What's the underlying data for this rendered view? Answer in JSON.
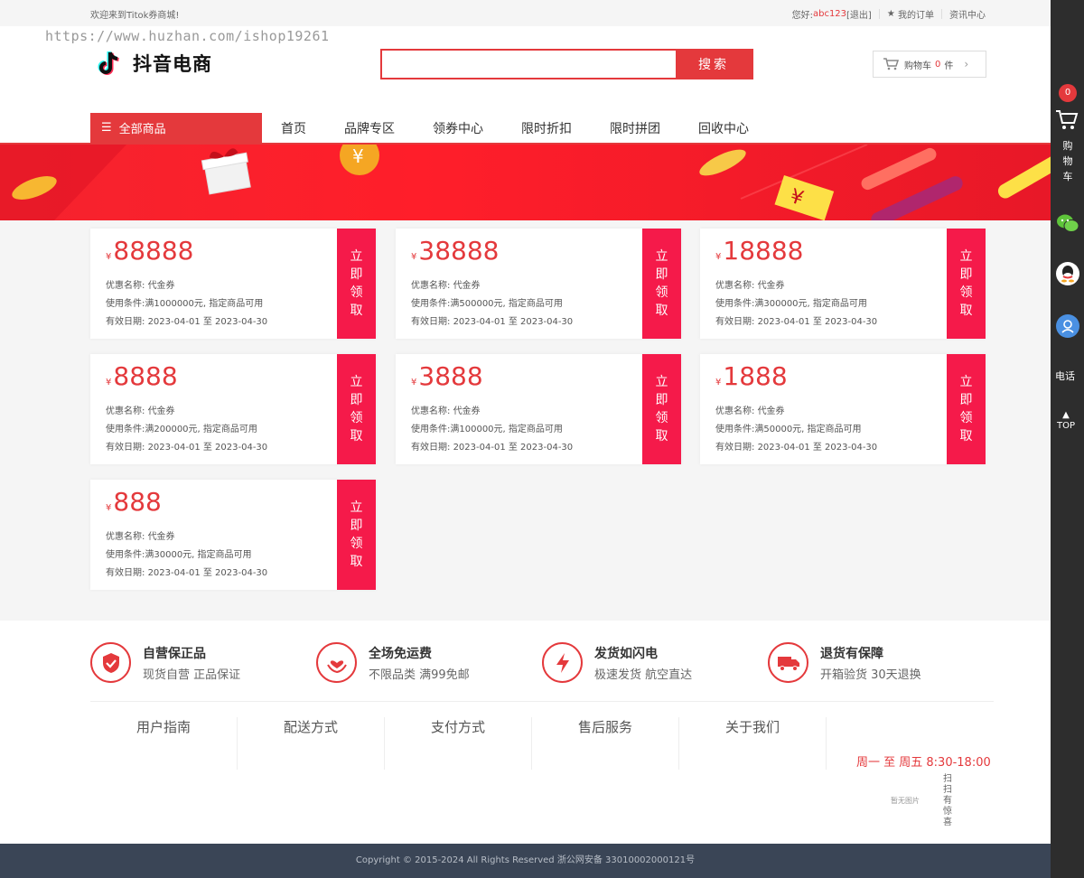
{
  "topbar": {
    "welcome": "欢迎来到Titok券商城!",
    "greeting": "您好:",
    "username": "abc123",
    "logout": "[退出]",
    "orders": "我的订单",
    "news": "资讯中心"
  },
  "header": {
    "watermark": "https://www.huzhan.com/ishop19261",
    "logo_text": "抖音电商",
    "search_placeholder": "",
    "search_button": "搜索",
    "cart_label": "购物车",
    "cart_count": "0",
    "cart_unit": "件"
  },
  "nav": {
    "all_categories": "全部商品",
    "links": [
      "首页",
      "品牌专区",
      "领券中心",
      "限时折扣",
      "限时拼团",
      "回收中心"
    ]
  },
  "coupons": [
    {
      "yen": "¥",
      "amount": "88888",
      "name_label": "优惠名称:",
      "name": "代金券",
      "cond_label": "使用条件:",
      "condition": "满1000000元, 指定商品可用",
      "date_label": "有效日期:",
      "dates": "2023-04-01 至 2023-04-30",
      "grab": [
        "立",
        "即",
        "领",
        "取"
      ]
    },
    {
      "yen": "¥",
      "amount": "38888",
      "name_label": "优惠名称:",
      "name": "代金券",
      "cond_label": "使用条件:",
      "condition": "满500000元, 指定商品可用",
      "date_label": "有效日期:",
      "dates": "2023-04-01 至 2023-04-30",
      "grab": [
        "立",
        "即",
        "领",
        "取"
      ]
    },
    {
      "yen": "¥",
      "amount": "18888",
      "name_label": "优惠名称:",
      "name": "代金券",
      "cond_label": "使用条件:",
      "condition": "满300000元, 指定商品可用",
      "date_label": "有效日期:",
      "dates": "2023-04-01 至 2023-04-30",
      "grab": [
        "立",
        "即",
        "领",
        "取"
      ]
    },
    {
      "yen": "¥",
      "amount": "8888",
      "name_label": "优惠名称:",
      "name": "代金券",
      "cond_label": "使用条件:",
      "condition": "满200000元, 指定商品可用",
      "date_label": "有效日期:",
      "dates": "2023-04-01 至 2023-04-30",
      "grab": [
        "立",
        "即",
        "领",
        "取"
      ]
    },
    {
      "yen": "¥",
      "amount": "3888",
      "name_label": "优惠名称:",
      "name": "代金券",
      "cond_label": "使用条件:",
      "condition": "满100000元, 指定商品可用",
      "date_label": "有效日期:",
      "dates": "2023-04-01 至 2023-04-30",
      "grab": [
        "立",
        "即",
        "领",
        "取"
      ]
    },
    {
      "yen": "¥",
      "amount": "1888",
      "name_label": "优惠名称:",
      "name": "代金券",
      "cond_label": "使用条件:",
      "condition": "满50000元, 指定商品可用",
      "date_label": "有效日期:",
      "dates": "2023-04-01 至 2023-04-30",
      "grab": [
        "立",
        "即",
        "领",
        "取"
      ]
    },
    {
      "yen": "¥",
      "amount": "888",
      "name_label": "优惠名称:",
      "name": "代金券",
      "cond_label": "使用条件:",
      "condition": "满30000元, 指定商品可用",
      "date_label": "有效日期:",
      "dates": "2023-04-01 至 2023-04-30",
      "grab": [
        "立",
        "即",
        "领",
        "取"
      ]
    }
  ],
  "services": [
    {
      "icon": "shield-check-icon",
      "title": "自营保正品",
      "desc": "现货自营 正品保证"
    },
    {
      "icon": "heart-hand-icon",
      "title": "全场免运费",
      "desc": "不限品类 满99免邮"
    },
    {
      "icon": "lightning-icon",
      "title": "发货如闪电",
      "desc": "极速发货 航空直达"
    },
    {
      "icon": "truck-icon",
      "title": "退货有保障",
      "desc": "开箱验货 30天退换"
    }
  ],
  "help_columns": [
    "用户指南",
    "配送方式",
    "支付方式",
    "售后服务",
    "关于我们"
  ],
  "hours": "周一 至 周五   8:30-18:00",
  "qr_missing": "暂无图片",
  "qr_caption": "扫扫有惊喜",
  "copyright": "Copyright © 2015-2024 All Rights Reserved 浙公网安备 33010002000121号",
  "sidebar": {
    "cart_badge": "0",
    "cart_label": "购物车",
    "phone_label": "电话",
    "top_label": "TOP"
  },
  "colors": {
    "accent": "#e4393c",
    "grab_button": "#f51a4a",
    "footer_bg": "#3a4556",
    "sidebar_bg": "#2d2d2d"
  }
}
